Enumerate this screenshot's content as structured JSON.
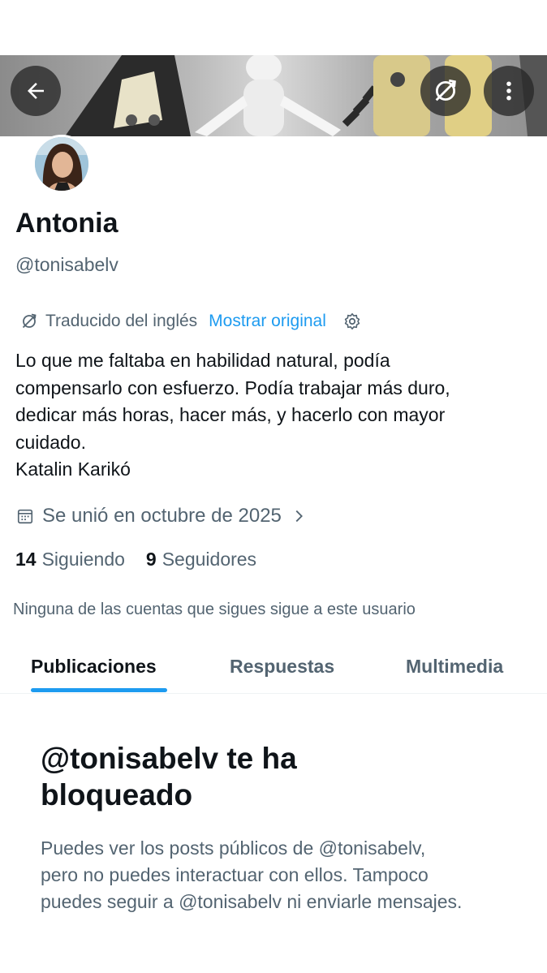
{
  "profile": {
    "name": "Antonia",
    "handle": "@tonisabelv",
    "translation": {
      "translated_label": "Traducido del inglés",
      "show_original_label": "Mostrar original"
    },
    "bio_lines": [
      "Lo que me faltaba en habilidad natural, podía",
      "compensarlo con esfuerzo. Podía trabajar más duro,",
      "dedicar más horas, hacer más, y hacerlo con mayor",
      "cuidado.",
      "Katalin Karikó"
    ],
    "joined": "Se unió en octubre de 2025",
    "following_count": "14",
    "following_label": "Siguiendo",
    "followers_count": "9",
    "followers_label": "Seguidores",
    "mutual_note": "Ninguna de las cuentas que sigues sigue a este usuario"
  },
  "tabs": [
    {
      "label": "Publicaciones",
      "active": true
    },
    {
      "label": "Respuestas",
      "active": false
    },
    {
      "label": "Multimedia",
      "active": false
    }
  ],
  "blocked": {
    "title_lines": [
      "@tonisabelv te ha",
      "bloqueado"
    ],
    "body_lines": [
      "Puedes ver los posts públicos de @tonisabelv,",
      "pero no puedes interactuar con ellos. Tampoco",
      "puedes seguir a @tonisabelv ni enviarle mensajes."
    ]
  },
  "icons": {
    "back": "arrow-left-icon",
    "translate_banner": "no-translate-icon",
    "more": "more-vertical-icon",
    "translate_small": "translate-icon",
    "settings": "gear-icon",
    "calendar": "calendar-icon",
    "chevron": "chevron-right-icon"
  },
  "colors": {
    "accent": "#1d9bf0",
    "text_primary": "#0f1419",
    "text_secondary": "#536471"
  }
}
